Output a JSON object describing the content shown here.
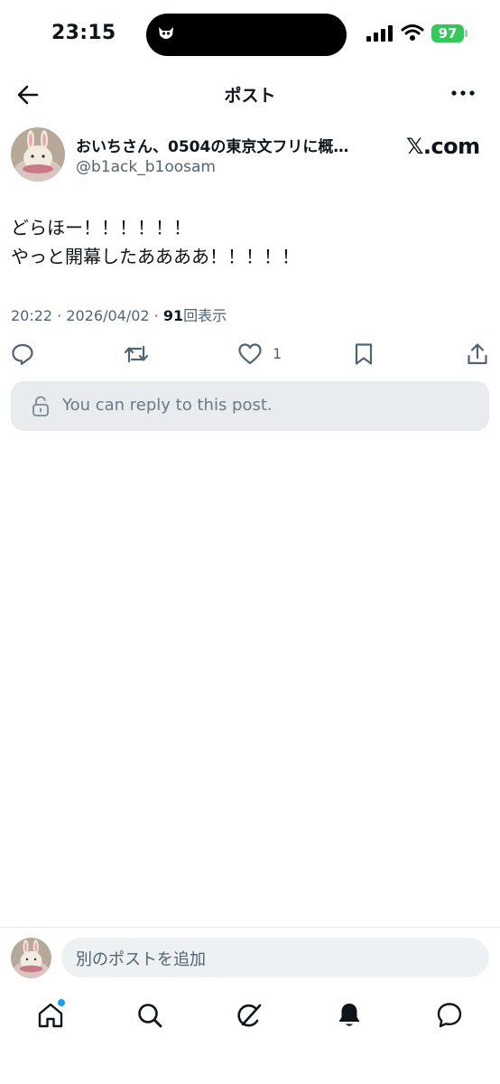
{
  "status_bar": {
    "time": "23:15",
    "battery": "97"
  },
  "header": {
    "title": "ポスト"
  },
  "author": {
    "display_name": "おいちさん、0504の東京文フリに概…",
    "handle": "@b1ack_b1oosam",
    "source_brand": "𝕏.com"
  },
  "post": {
    "text": "どらほー！！！！！！\nやっと開幕したああああ！！！！！",
    "timestamp": "20:22 · 2026/04/02 · ",
    "views_count": "91",
    "views_label": "回表示"
  },
  "actions": {
    "like_count": "1"
  },
  "reply_notice": "You can reply to this post.",
  "composer": {
    "placeholder": "別のポストを追加"
  },
  "colors": {
    "accent": "#1d9bf0",
    "muted": "#536471",
    "battery": "#34c759"
  }
}
